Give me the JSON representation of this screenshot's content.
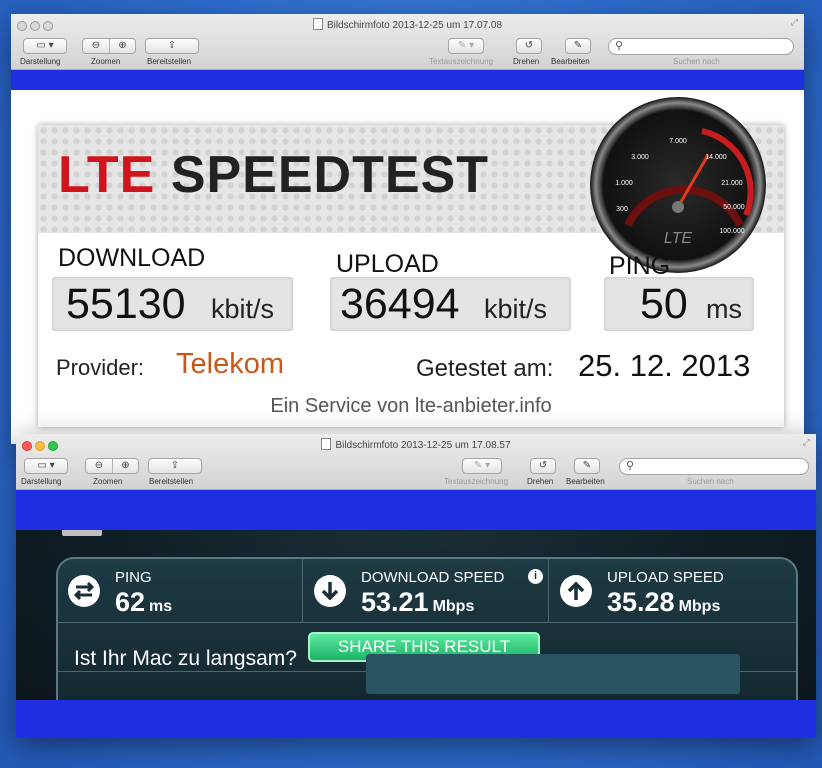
{
  "window1": {
    "title": "Bildschirmfoto 2013-12-25 um 17.07.08",
    "toolbar": {
      "darstellung": "Darstellung",
      "zoomen": "Zoomen",
      "bereitstellen": "Bereitstellen",
      "textauszeichnung": "Textauszeichnung",
      "drehen": "Drehen",
      "bearbeiten": "Bearbeiten",
      "suchen": "Suchen nach"
    }
  },
  "lte": {
    "title_red": "LTE",
    "title_dark": "SPEEDTEST",
    "gauge_labels": [
      "7.000",
      "3.000",
      "14.000",
      "1.000",
      "21.000",
      "300",
      "50.000",
      "100.000"
    ],
    "gauge_brand": "LTE",
    "download_label": "DOWNLOAD",
    "download_value": "55130",
    "download_unit": "kbit/s",
    "upload_label": "UPLOAD",
    "upload_value": "36494",
    "upload_unit": "kbit/s",
    "ping_label": "PING",
    "ping_value": "50",
    "ping_unit": "ms",
    "provider_label": "Provider:",
    "provider_value": "Telekom",
    "date_label": "Getestet am:",
    "date_value": "25. 12. 2013",
    "service": "Ein Service von lte-anbieter.info"
  },
  "window2": {
    "title": "Bildschirmfoto 2013-12-25 um 17.08.57",
    "toolbar": {
      "darstellung": "Darstellung",
      "zoomen": "Zoomen",
      "bereitstellen": "Bereitstellen",
      "textauszeichnung": "Textauszeichnung",
      "drehen": "Drehen",
      "bearbeiten": "Bearbeiten",
      "suchen": "Suchen nach"
    }
  },
  "speedtest": {
    "ping_label": "PING",
    "ping_value": "62",
    "ping_unit": "ms",
    "download_label": "DOWNLOAD SPEED",
    "download_value": "53.21",
    "download_unit": "Mbps",
    "upload_label": "UPLOAD SPEED",
    "upload_value": "35.28",
    "upload_unit": "Mbps",
    "share": "SHARE THIS RESULT",
    "question": "Ist Ihr Mac zu langsam?"
  },
  "colors": {
    "band": "#1e2ee0",
    "lte_red": "#d0141b",
    "provider": "#c45a1a",
    "share_green": "#1ab466"
  }
}
